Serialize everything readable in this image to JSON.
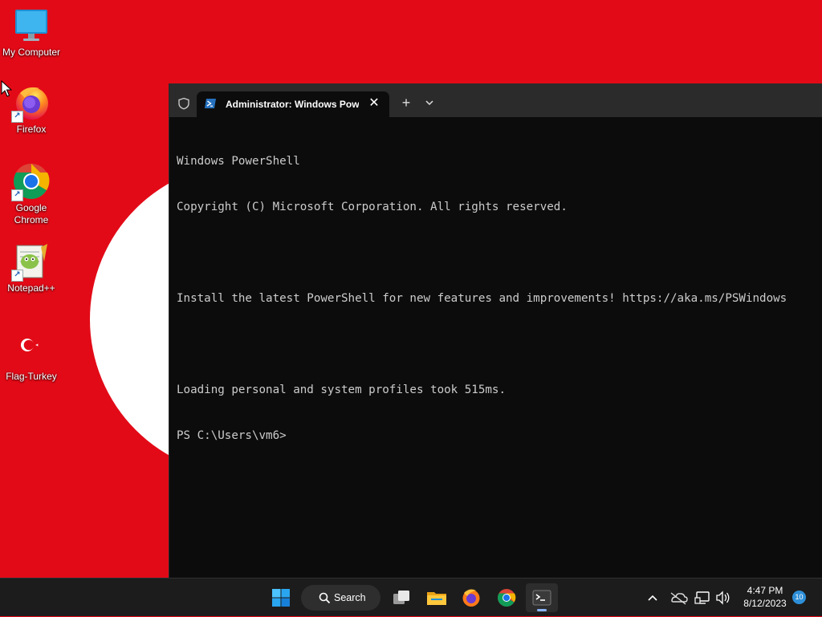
{
  "desktop": {
    "icons": [
      {
        "label": "My Computer"
      },
      {
        "label": "Firefox"
      },
      {
        "label": "Google Chrome",
        "label_line1": "Google",
        "label_line2": "Chrome"
      },
      {
        "label": "Notepad++"
      },
      {
        "label": "Flag-Turkey"
      }
    ],
    "wallpaper": {
      "background": "#e30a17",
      "crescent": "#ffffff"
    }
  },
  "terminal": {
    "tab": {
      "title": "Administrator: Windows Powe",
      "icon": "powershell-icon"
    },
    "new_tab_symbol": "+",
    "close_symbol": "✕",
    "console_lines": [
      "Windows PowerShell",
      "Copyright (C) Microsoft Corporation. All rights reserved.",
      "",
      "Install the latest PowerShell for new features and improvements! https://aka.ms/PSWindows",
      "",
      "Loading personal and system profiles took 515ms.",
      "PS C:\\Users\\vm6>"
    ],
    "colors": {
      "background": "#0c0c0c",
      "titlebar": "#2b2b2b",
      "text": "#cccccc"
    }
  },
  "taskbar": {
    "search_label": "Search",
    "pinned": [
      "start-icon",
      "search",
      "task-view-icon",
      "file-explorer-icon",
      "firefox-icon",
      "chrome-icon",
      "terminal-icon"
    ],
    "active_app": "terminal-icon",
    "tray_icons": [
      "chevron-up-icon",
      "onedrive-icon",
      "network-icon",
      "volume-icon"
    ],
    "clock": {
      "time": "4:47 PM",
      "date": "8/12/2023"
    },
    "notification_count": "10"
  }
}
